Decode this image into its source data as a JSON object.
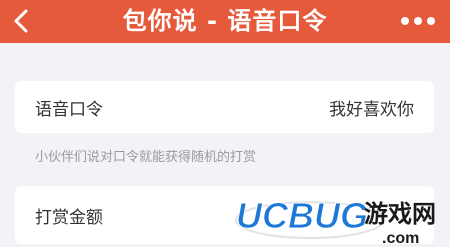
{
  "header": {
    "title": "包你说 - 语音口令",
    "back_icon": "chevron-left-icon",
    "more_icon": "more-dots-icon"
  },
  "voice_password": {
    "label": "语音口令",
    "value": "我好喜欢你"
  },
  "hint": "小伙伴们说对口令就能获得随机的打赏",
  "reward_amount": {
    "label": "打赏金额"
  },
  "watermark": {
    "brand": "UCBUG",
    "suffix": "游戏网",
    "domain": ".com"
  },
  "colors": {
    "header_bg": "#e65a3c",
    "page_bg": "#f3f2f7"
  }
}
